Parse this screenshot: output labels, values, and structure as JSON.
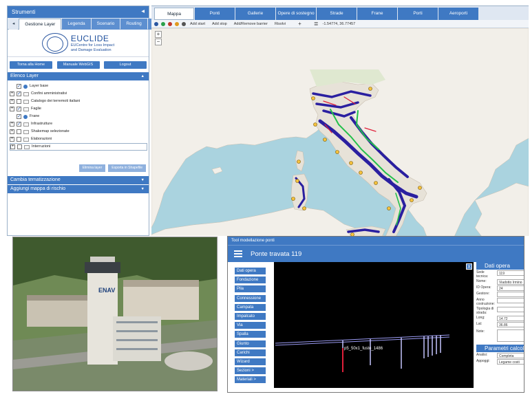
{
  "left_panel": {
    "title": "Strumenti",
    "tabs": [
      "Gestione Layer",
      "Legenda",
      "Scenario",
      "Routing"
    ],
    "tab_more": "▸",
    "logo": {
      "name": "EUCLIDE",
      "subtitle_1": "EUCentre for Loss Impact",
      "subtitle_2": "and Damage Evaluation"
    },
    "buttons": [
      "Torna alla Home",
      "Manuale WebGIS",
      "Logout"
    ],
    "layer_section": "Elenco Layer",
    "layers": [
      {
        "label": "Layer base",
        "checked": true,
        "kind": "dot",
        "expand": false,
        "indent": true
      },
      {
        "label": "Confini amministrativi",
        "checked": true,
        "kind": "folder",
        "expand": true
      },
      {
        "label": "Catalogo dei terremoti italiani",
        "checked": false,
        "kind": "folder",
        "expand": true
      },
      {
        "label": "Faglie",
        "checked": true,
        "kind": "folder",
        "expand": true
      },
      {
        "label": "Frane",
        "checked": true,
        "kind": "dot",
        "expand": false,
        "indent": true
      },
      {
        "label": "Infrastrutture",
        "checked": true,
        "kind": "folder",
        "expand": true
      },
      {
        "label": "Shakemap selezionate",
        "checked": false,
        "kind": "folder",
        "expand": true
      },
      {
        "label": "Elaborazioni",
        "checked": false,
        "kind": "folder",
        "expand": true
      },
      {
        "label": "Interruzioni",
        "checked": false,
        "kind": "folder",
        "expand": true,
        "selected": true
      }
    ],
    "layer_buttons": [
      "Elimina layer",
      "Esporta in Shapefile"
    ],
    "section_theme": "Cambia tematizzazione",
    "section_risk": "Aggiungi mappa di rischio"
  },
  "map": {
    "tabs": [
      "Mappa",
      "Ponti",
      "Gallerie",
      "Opere di sostegno",
      "Strade",
      "Frane",
      "Porti",
      "Aeroporti"
    ],
    "toolbar": [
      "Add start",
      "Add stop",
      "Add/Remove barrier",
      "Risolvi"
    ],
    "coords": "-1.54774, 36.77457",
    "zoom_in": "+",
    "zoom_out": "−",
    "colors": {
      "sea": "#aad3df",
      "land": "#f2efe9",
      "network_blue": "#2a1fa0",
      "network_green": "#22c04a",
      "network_red": "#e0203a"
    }
  },
  "photo": {
    "tower_label": "ENAV"
  },
  "tool": {
    "window_title": "Tool modellazione ponti",
    "header": "Ponte travata 119",
    "menu": [
      "Dati opera",
      "Fondazione",
      "Pila",
      "Connessione",
      "Campata",
      "Impalcato",
      "Via",
      "Spalla",
      "Giunto",
      "Carichi",
      "Wizard",
      "Sezioni >",
      "Materiali >"
    ],
    "close": "X",
    "model_label": "p5_50x1_fusto_1486",
    "props_title": "Dati opera",
    "props": [
      {
        "label": "Sede tecnica:",
        "value": "119"
      },
      {
        "label": "Nome:",
        "value": "Viadotto Irmino"
      },
      {
        "label": "ID Opera:",
        "value": "24"
      },
      {
        "label": "Gestore:",
        "value": ""
      },
      {
        "label": "Anno costruzione:",
        "value": ""
      },
      {
        "label": "Tipologia di strada:",
        "value": ""
      },
      {
        "label": "Long:",
        "value": "14.72"
      },
      {
        "label": "Lat:",
        "value": "36.86"
      }
    ],
    "note_label": "Note:",
    "params_title": "Parametri calcolo",
    "params": [
      {
        "label": "Analisi:",
        "value": "Completa"
      },
      {
        "label": "Appoggi:",
        "value": "Legame costi"
      }
    ]
  }
}
